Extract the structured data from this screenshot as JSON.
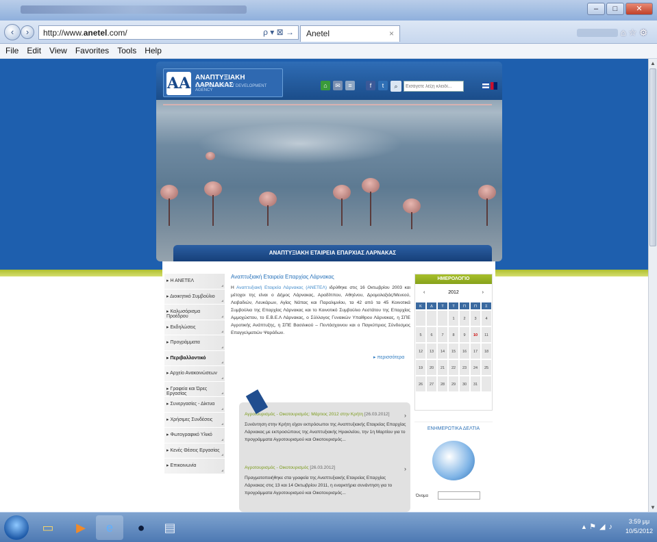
{
  "browser": {
    "url_prefix": "http://www.",
    "url_domain": "anetel",
    "url_suffix": ".com/",
    "tab_title": "Anetel",
    "menus": [
      "File",
      "Edit",
      "View",
      "Favorites",
      "Tools",
      "Help"
    ],
    "address_tools": "ρ ▾ ⊠ →"
  },
  "site": {
    "logo_mark": "AA",
    "logo_title": "ΑΝΑΠΤΥΞΙΑΚΗ ΛΑΡΝΑΚΑΣ",
    "logo_subtitle": "LARNACA DISTRICT DEVELOPMENT AGENCY",
    "search_placeholder": "Εισάγετε λέξη κλειδί...",
    "banner_text": "ΑΝΑΠΤΥΞΙΑΚΗ ΕΤΑΙΡΕΙΑ ΕΠΑΡΧΙΑΣ ΛΑΡΝΑΚΑΣ",
    "nav": [
      {
        "label": "Η ΑΝΕΤΕΛ"
      },
      {
        "label": "Διοικητικό Συμβούλιο"
      },
      {
        "label": "Καλωσόρισμα Προέδρου"
      },
      {
        "label": "Εκδηλώσεις"
      },
      {
        "label": "Προγράμματα"
      },
      {
        "label": "Περιβαλλοντικό"
      },
      {
        "label": "Αρχείο Ανακοινώσεων"
      },
      {
        "label": "Γραφεία και Ώρες Εργασίας"
      },
      {
        "label": "Συνεργασίες - Δίκτυα"
      },
      {
        "label": "Χρήσιμες Συνδέσεις"
      },
      {
        "label": "Φωτογραφικό Υλικό"
      },
      {
        "label": "Κενές Θέσεις Εργασίας"
      },
      {
        "label": "Επικοινωνία"
      }
    ],
    "article_title": "Αναπτυξιακή Εταιρεία Επαρχίας Λάρνακας",
    "article_lead": "Η ",
    "article_highlight": "Αναπτυξιακή Εταιρεία Λάρνακας (ΑΝΕΤΕΛ)",
    "article_body": " ιδρύθηκε στις 16 Οκτωβρίου 2003 και μέτοχοι της είναι ο Δήμος Λάρνακας, Αραδίππου, Αθηένου, Δρομολαξιάς/Μενεού, Λειβαδιών, Λευκάρων, Αγίας Νάπας και Παραλιμνίου, τα 42 από τα 45 Κοινοτικά Συμβούλια της Επαρχίας Λάρνακας και το Κοινοτικό Συμβούλιο Λεστάτου της Επαρχίας Αμμοχώστου, το Ε.Β.Ε.Λ Λάρνακας, ο Σύλλογος Γυναικών Υπαίθρου Λάρνακας, η ΣΠΕ Αγροτικής Ανάπτυξης, η ΣΠΕ Βασιλικού – Πεντάσχοινου και ο Παγκύπριος Σύνδεσμος Επαγγελματιών Ψαράδων.",
    "more_label": "περισσότερα",
    "news": [
      {
        "title": "Αγροτουρισμός - Οικοτουρισμός: Μάρτιος 2012 στην Κρήτη",
        "date": "[26.03.2012]",
        "body": "Συνάντηση στην Κρήτη είχαν εκπρόσωποι της Αναπτυξιακής Εταιρείας Επαρχίας Λάρνακας με εκπροσώπους της Αναπτυξιακής Ηρακλείου, την 1η Μαρτίου για το προγράμματα Αγροτουρισμού και Οικοτουρισμός..."
      },
      {
        "title": "Αγροτουρισμός - Οικοτουρισμός",
        "date": "[26.03.2012]",
        "body": "Πραγματοποιήθηκε στα γραφεία της Αναπτυξιακής Εταιρείας Επαρχίας Λάρνακας στις 13 και 14 Οκτωβρίου 2011, η εναρκτήρια συνάντηση για το προγράμματα Αγροτουρισμού και Οικοτουρισμός..."
      }
    ],
    "calendar": {
      "title": "ΗΜΕΡΟΛΟΓΙΟ",
      "year": "2012",
      "prev": "‹",
      "next": "›",
      "days": [
        "Κ",
        "Δ",
        "Τ",
        "Τ",
        "Π",
        "Π",
        "Σ"
      ],
      "weeks": [
        [
          "",
          "",
          "",
          "1",
          "2",
          "3",
          "4"
        ],
        [
          "5",
          "6",
          "7",
          "8",
          "9",
          "10",
          "11"
        ],
        [
          "12",
          "13",
          "14",
          "15",
          "16",
          "17",
          "18"
        ],
        [
          "19",
          "20",
          "21",
          "22",
          "23",
          "24",
          "25"
        ],
        [
          "26",
          "27",
          "28",
          "29",
          "30",
          "31",
          ""
        ]
      ],
      "today": "10"
    },
    "newsletter_title": "ΕΝΗΜΕΡΩΤΙΚΑ ΔΕΛΤΙΑ",
    "newsletter_name_label": "Όνομα"
  },
  "taskbar": {
    "time": "3:59 μμ",
    "date": "10/5/2012"
  },
  "colors": {
    "accent_green": "#a7bf2b",
    "brand_blue": "#1e5fae"
  }
}
